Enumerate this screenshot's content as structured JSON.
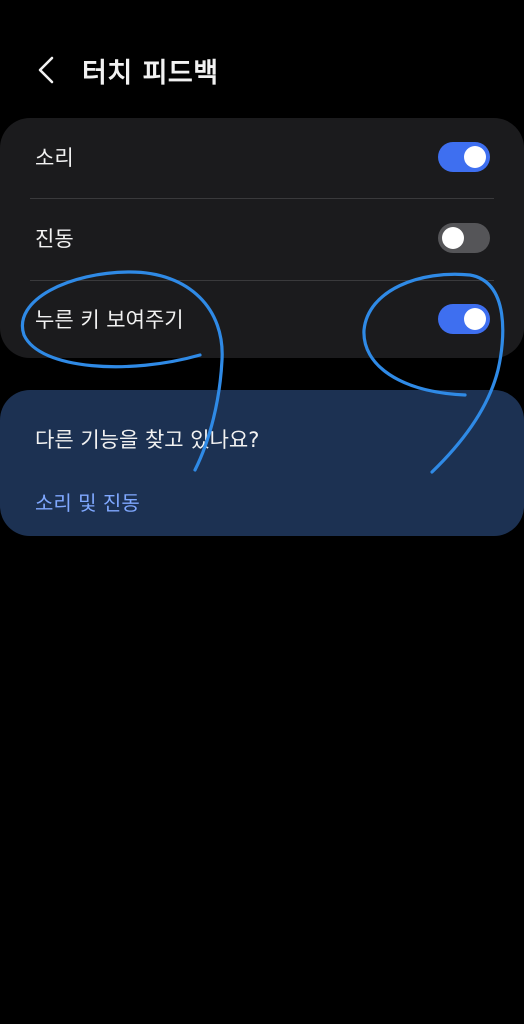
{
  "header": {
    "title": "터치 피드백",
    "back_icon": "chevron-left-icon"
  },
  "settings": {
    "items": [
      {
        "label": "소리",
        "enabled": true
      },
      {
        "label": "진동",
        "enabled": false
      },
      {
        "label": "누른 키 보여주기",
        "enabled": true
      }
    ]
  },
  "suggestions": {
    "title": "다른 기능을 찾고 있나요?",
    "link_label": "소리 및 진동"
  },
  "colors": {
    "background": "#000000",
    "card": "#1b1b1d",
    "suggest_card": "#1c3152",
    "toggle_on": "#3e6ff0",
    "toggle_off": "#555558",
    "link": "#7fa8ff",
    "annotation": "#2f8ae6"
  }
}
